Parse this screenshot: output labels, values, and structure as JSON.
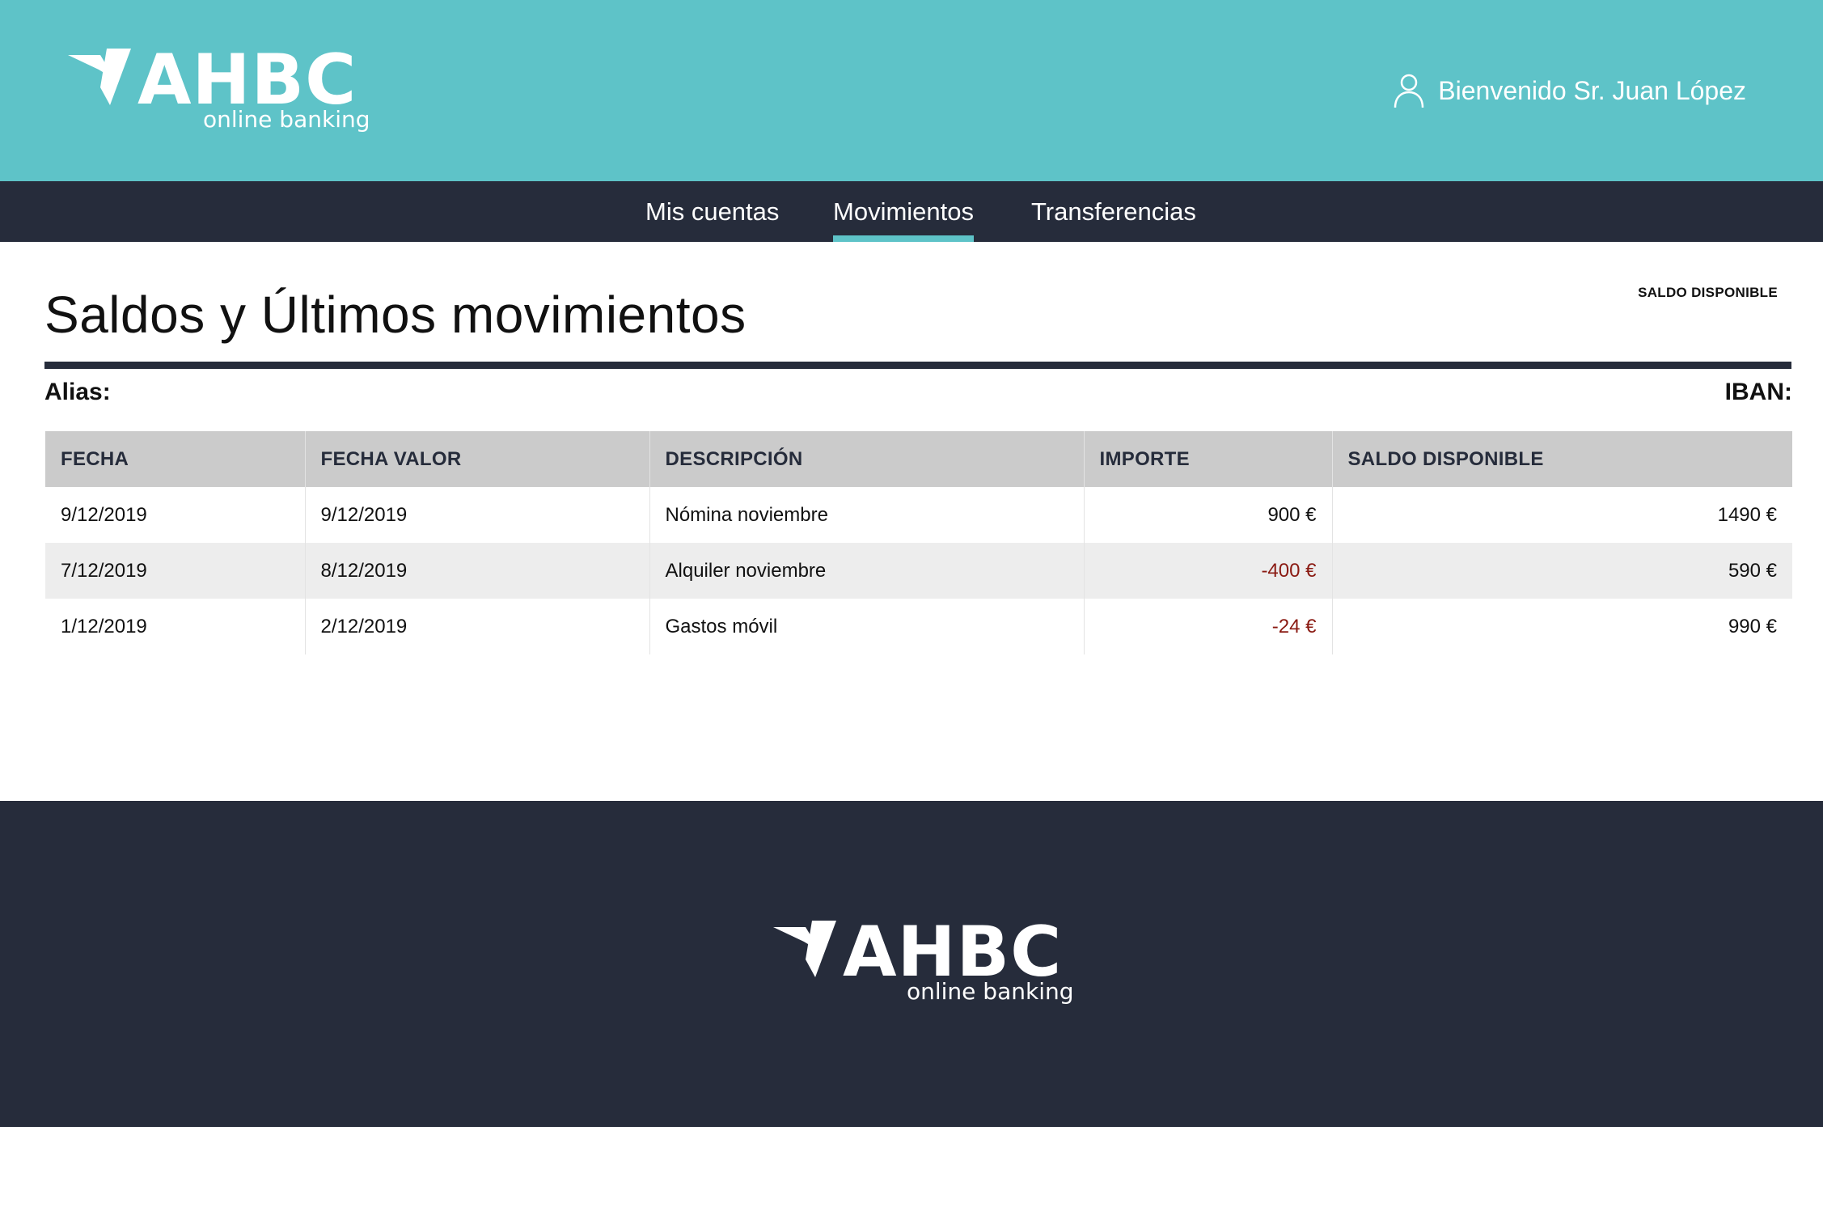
{
  "header": {
    "logo": {
      "brand": "AHBC",
      "tagline": "online banking",
      "mark_icon": "bird-logo-icon"
    },
    "welcome_text": "Bienvenido Sr. Juan López",
    "user_icon": "user-icon"
  },
  "nav": {
    "items": [
      {
        "label": "Mis cuentas",
        "active": false
      },
      {
        "label": "Movimientos",
        "active": true
      },
      {
        "label": "Transferencias",
        "active": false
      }
    ]
  },
  "main": {
    "title": "Saldos y Últimos movimientos",
    "saldo_caption": "SALDO DISPONIBLE",
    "alias_label": "Alias:",
    "iban_label": "IBAN:",
    "table": {
      "headers": [
        "FECHA",
        "FECHA VALOR",
        "DESCRIPCIÓN",
        "IMPORTE",
        "SALDO DISPONIBLE"
      ],
      "rows": [
        {
          "fecha": "9/12/2019",
          "fecha_valor": "9/12/2019",
          "descripcion": "Nómina noviembre",
          "importe": "900 €",
          "saldo": "1490 €"
        },
        {
          "fecha": "7/12/2019",
          "fecha_valor": "8/12/2019",
          "descripcion": "Alquiler noviembre",
          "importe": "-400 €",
          "saldo": "590 €"
        },
        {
          "fecha": "1/12/2019",
          "fecha_valor": "2/12/2019",
          "descripcion": "Gastos móvil",
          "importe": "-24 €",
          "saldo": "990 €"
        }
      ]
    }
  },
  "footer": {
    "logo": {
      "brand": "AHBC",
      "tagline": "online banking"
    }
  },
  "colors": {
    "header_bg": "#5ec3c8",
    "nav_bg": "#262c3b",
    "accent": "#5ec3c8",
    "negative_amount": "#8a1a12",
    "table_header_bg": "#cbcbcb",
    "row_alt_bg": "#ededed"
  }
}
